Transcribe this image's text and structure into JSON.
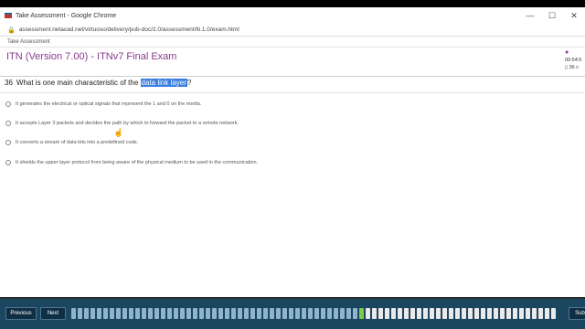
{
  "browser": {
    "window_title": "Take Assessment - Google Chrome",
    "url": "assessment.netacad.net/virtuoso/delivery/pub-doc/2.0/assessment/lti.1.0/exam.html",
    "tab_label": "Take Assessment"
  },
  "exam": {
    "title": "ITN (Version 7.00) - ITNv7 Final Exam",
    "timer": "00:54:5",
    "timer_sub": "36 c"
  },
  "question": {
    "number": "36",
    "text_before": "What is one main characteristic of the ",
    "highlight": "data link layer",
    "text_after": "?",
    "options": [
      "It generates the electrical or optical signals that represent the 1 and 0 on the media.",
      "It accepts Layer 3 packets and decides the path by which to forward the packet to a remote network.",
      "It converts a stream of data bits into a predefined code.",
      "It shields the upper layer protocol from being aware of the physical medium to be used in the communication."
    ]
  },
  "navigation": {
    "previous_label": "Previous",
    "next_label": "Next",
    "submit_label": "Subm",
    "progress": {
      "total_shown": 76,
      "answered": 45,
      "current": 46
    }
  }
}
